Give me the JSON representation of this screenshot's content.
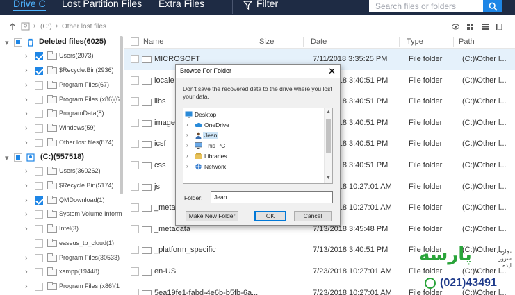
{
  "topbar": {
    "tabs": [
      {
        "label": "Drive C",
        "active": true
      },
      {
        "label": "Lost Partition Files",
        "active": false
      },
      {
        "label": "Extra Files",
        "active": false
      }
    ],
    "filter_label": "Filter",
    "search_placeholder": "Search files or folders",
    "colors": {
      "bar": "#1e2b44",
      "accent": "#4fb4ff",
      "search_button": "#1e86e6"
    }
  },
  "pathbar": {
    "segments": [
      "(C:)",
      "Other lost files"
    ]
  },
  "tree": {
    "groups": [
      {
        "label": "Deleted files(6025)",
        "checked": "partial",
        "items": [
          {
            "label": "Users(2073)",
            "checked": true
          },
          {
            "label": "$Recycle.Bin(2936)",
            "checked": true
          },
          {
            "label": "Program Files(67)",
            "checked": false
          },
          {
            "label": "Program Files (x86)(6)",
            "checked": false
          },
          {
            "label": "ProgramData(8)",
            "checked": false
          },
          {
            "label": "Windows(59)",
            "checked": false
          },
          {
            "label": "Other lost files(874)",
            "checked": false
          }
        ]
      },
      {
        "label": "(C:)(557518)",
        "checked": "partial",
        "items": [
          {
            "label": "Users(360262)",
            "checked": false
          },
          {
            "label": "$Recycle.Bin(5174)",
            "checked": false
          },
          {
            "label": "QMDownload(1)",
            "checked": true
          },
          {
            "label": "System Volume Inform",
            "checked": false
          },
          {
            "label": "Intel(3)",
            "checked": false
          },
          {
            "label": "easeus_tb_cloud(1)",
            "checked": false
          },
          {
            "label": "Program Files(30533)",
            "checked": false
          },
          {
            "label": "xampp(19448)",
            "checked": false
          },
          {
            "label": "Program Files (x86)(1",
            "checked": false
          }
        ]
      }
    ]
  },
  "list": {
    "columns": [
      "Name",
      "Size",
      "Date",
      "Type",
      "Path"
    ],
    "rows": [
      {
        "name": "MICROSOFT",
        "date": "7/11/2018 3:35:25 PM",
        "type": "File folder",
        "path": "(C:)\\Other l...",
        "selected": true
      },
      {
        "name": "locale",
        "date": "7/13/2018 3:40:51 PM",
        "type": "File folder",
        "path": "(C:)\\Other l..."
      },
      {
        "name": "libs",
        "date": "7/13/2018 3:40:51 PM",
        "type": "File folder",
        "path": "(C:)\\Other l..."
      },
      {
        "name": "images",
        "date": "7/13/2018 3:40:51 PM",
        "type": "File folder",
        "path": "(C:)\\Other l..."
      },
      {
        "name": "icsf",
        "date": "7/13/2018 3:40:51 PM",
        "type": "File folder",
        "path": "(C:)\\Other l..."
      },
      {
        "name": "css",
        "date": "7/13/2018 3:40:51 PM",
        "type": "File folder",
        "path": "(C:)\\Other l..."
      },
      {
        "name": "js",
        "date": "7/18/2018 10:27:01 AM",
        "type": "File folder",
        "path": "(C:)\\Other l..."
      },
      {
        "name": "_metadata",
        "date": "7/18/2018 10:27:01 AM",
        "type": "File folder",
        "path": "(C:)\\Other l..."
      },
      {
        "name": "_metadata",
        "date": "7/13/2018 3:45:48 PM",
        "type": "File folder",
        "path": "(C:)\\Other l..."
      },
      {
        "name": "_platform_specific",
        "date": "7/13/2018 3:40:51 PM",
        "type": "File folder",
        "path": "(C:)\\Other l..."
      },
      {
        "name": "en-US",
        "date": "7/23/2018 10:27:01 AM",
        "type": "File folder",
        "path": "(C:)\\Other l..."
      },
      {
        "name": "5ea19fe1-fabd-4e6b-b5fb-6a...",
        "date": "7/23/2018 10:27:01 AM",
        "type": "File folder",
        "path": "(C:)\\Other l..."
      }
    ]
  },
  "dialog": {
    "title": "Browse For Folder",
    "close_glyph": "✕",
    "message": "Don't save the recovered data to the drive where you lost your data.",
    "tree": [
      {
        "label": "Desktop",
        "level": 0,
        "icon": "desktop-icon"
      },
      {
        "label": "OneDrive",
        "level": 1,
        "icon": "cloud-icon"
      },
      {
        "label": "Jean",
        "level": 1,
        "icon": "user-icon",
        "selected": true
      },
      {
        "label": "This PC",
        "level": 1,
        "icon": "computer-icon"
      },
      {
        "label": "Libraries",
        "level": 1,
        "icon": "library-icon"
      },
      {
        "label": "Network",
        "level": 1,
        "icon": "network-icon"
      }
    ],
    "folder_label": "Folder:",
    "folder_value": "Jean",
    "new_folder_button": "Make New Folder",
    "ok_button": "OK",
    "cancel_button": "Cancel"
  },
  "watermark": {
    "brand": "پارسه",
    "side_text": [
      "تجارت",
      "سرور",
      "ایده"
    ],
    "phone": "(021)43491"
  }
}
